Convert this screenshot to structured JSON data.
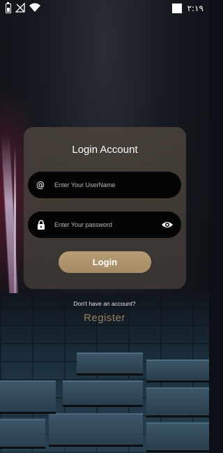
{
  "status_bar": {
    "time": "٢:١٩",
    "icons": [
      "battery-icon",
      "no-signal-icon",
      "wifi-icon",
      "notification-square-icon"
    ]
  },
  "login_card": {
    "title": "Login Account",
    "username_field": {
      "icon": "at-icon",
      "prefix_glyph": "@",
      "placeholder": "Enter Your UserName",
      "value": ""
    },
    "password_field": {
      "icon": "lock-icon",
      "placeholder": "Enter Your password",
      "value": "",
      "toggle_icon": "eye-icon"
    },
    "login_button_label": "Login"
  },
  "footer": {
    "no_account_text": "Don't have an account?",
    "register_label": "Register"
  },
  "colors": {
    "accent_gold": "#a68b66",
    "register_text": "#9a7f5f",
    "field_bg": "#050505",
    "card_bg": "#4b433b"
  }
}
